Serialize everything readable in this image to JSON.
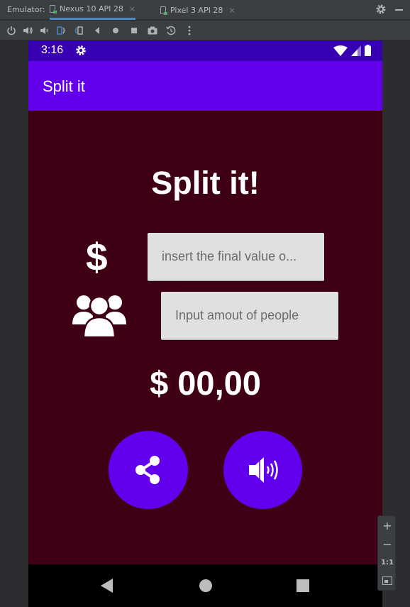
{
  "emulator": {
    "label": "Emulator:",
    "tabs": [
      {
        "label": "Nexus 10 API 28",
        "close": "×"
      },
      {
        "label": "Pixel 3 API 28",
        "close": "×"
      }
    ],
    "toolbar_icons": [
      "power-icon",
      "volume-up-icon",
      "volume-down-icon",
      "rotate-left-icon",
      "rotate-right-icon",
      "back-icon",
      "home-icon",
      "overview-icon",
      "camera-icon",
      "snapshot-icon",
      "more-icon"
    ]
  },
  "status_bar": {
    "time": "3:16"
  },
  "app_bar": {
    "title": "Split it"
  },
  "main": {
    "heading": "Split it!",
    "dollar_symbol": "$",
    "value_placeholder": "insert the final value o...",
    "people_placeholder": "Input amout of people",
    "total": "$ 00,00"
  },
  "buttons": {
    "share_icon": "share-icon",
    "sound_icon": "volume-icon"
  },
  "zoom": {
    "plus": "+",
    "minus": "−",
    "one_to_one": "1:1"
  },
  "colors": {
    "status_bar": "#3700b3",
    "app_bar": "#6200ee",
    "background": "#3f0016",
    "button": "#6200ee"
  }
}
